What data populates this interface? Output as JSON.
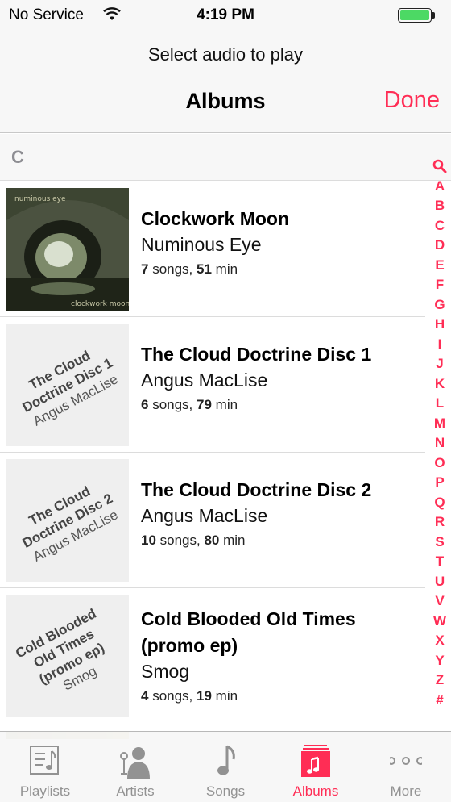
{
  "status_bar": {
    "carrier": "No Service",
    "time": "4:19 PM",
    "battery_level": 1.0
  },
  "header": {
    "prompt": "Select audio to play",
    "title": "Albums",
    "done_label": "Done"
  },
  "section_letter": "C",
  "albums": [
    {
      "title": "Clockwork Moon",
      "artist": "Numinous Eye",
      "songs": "7",
      "songs_unit": " songs, ",
      "minutes": "51",
      "min_unit": " min",
      "art_text_top": "numinous eye",
      "art_text_bottom": "clockwork moon"
    },
    {
      "title": "The Cloud Doctrine Disc 1",
      "artist": "Angus MacLise",
      "songs": "6",
      "songs_unit": " songs, ",
      "minutes": "79",
      "min_unit": " min",
      "art_title_lines": [
        "The Cloud",
        "Doctrine Disc 1"
      ],
      "art_artist": "Angus MacLise"
    },
    {
      "title": "The Cloud Doctrine Disc 2",
      "artist": "Angus MacLise",
      "songs": "10",
      "songs_unit": " songs, ",
      "minutes": "80",
      "min_unit": " min",
      "art_title_lines": [
        "The Cloud",
        "Doctrine Disc 2"
      ],
      "art_artist": "Angus MacLise"
    },
    {
      "title_lines": [
        "Cold Blooded Old Times",
        "(promo ep)"
      ],
      "artist": "Smog",
      "songs": "4",
      "songs_unit": " songs, ",
      "minutes": "19",
      "min_unit": " min",
      "art_title_lines": [
        "Cold Blooded",
        "Old Times",
        "(promo ep)"
      ],
      "art_artist": "Smog"
    }
  ],
  "index_letters": [
    "A",
    "B",
    "C",
    "D",
    "E",
    "F",
    "G",
    "H",
    "I",
    "J",
    "K",
    "L",
    "M",
    "N",
    "O",
    "P",
    "Q",
    "R",
    "S",
    "T",
    "U",
    "V",
    "W",
    "X",
    "Y",
    "Z",
    "#"
  ],
  "tabs": [
    {
      "label": "Playlists",
      "icon": "playlists-icon",
      "active": false
    },
    {
      "label": "Artists",
      "icon": "artists-icon",
      "active": false
    },
    {
      "label": "Songs",
      "icon": "songs-icon",
      "active": false
    },
    {
      "label": "Albums",
      "icon": "albums-icon",
      "active": true
    },
    {
      "label": "More",
      "icon": "more-icon",
      "active": false
    }
  ],
  "colors": {
    "accent": "#ff2d55",
    "battery": "#4cd964",
    "inactive": "#929292"
  }
}
